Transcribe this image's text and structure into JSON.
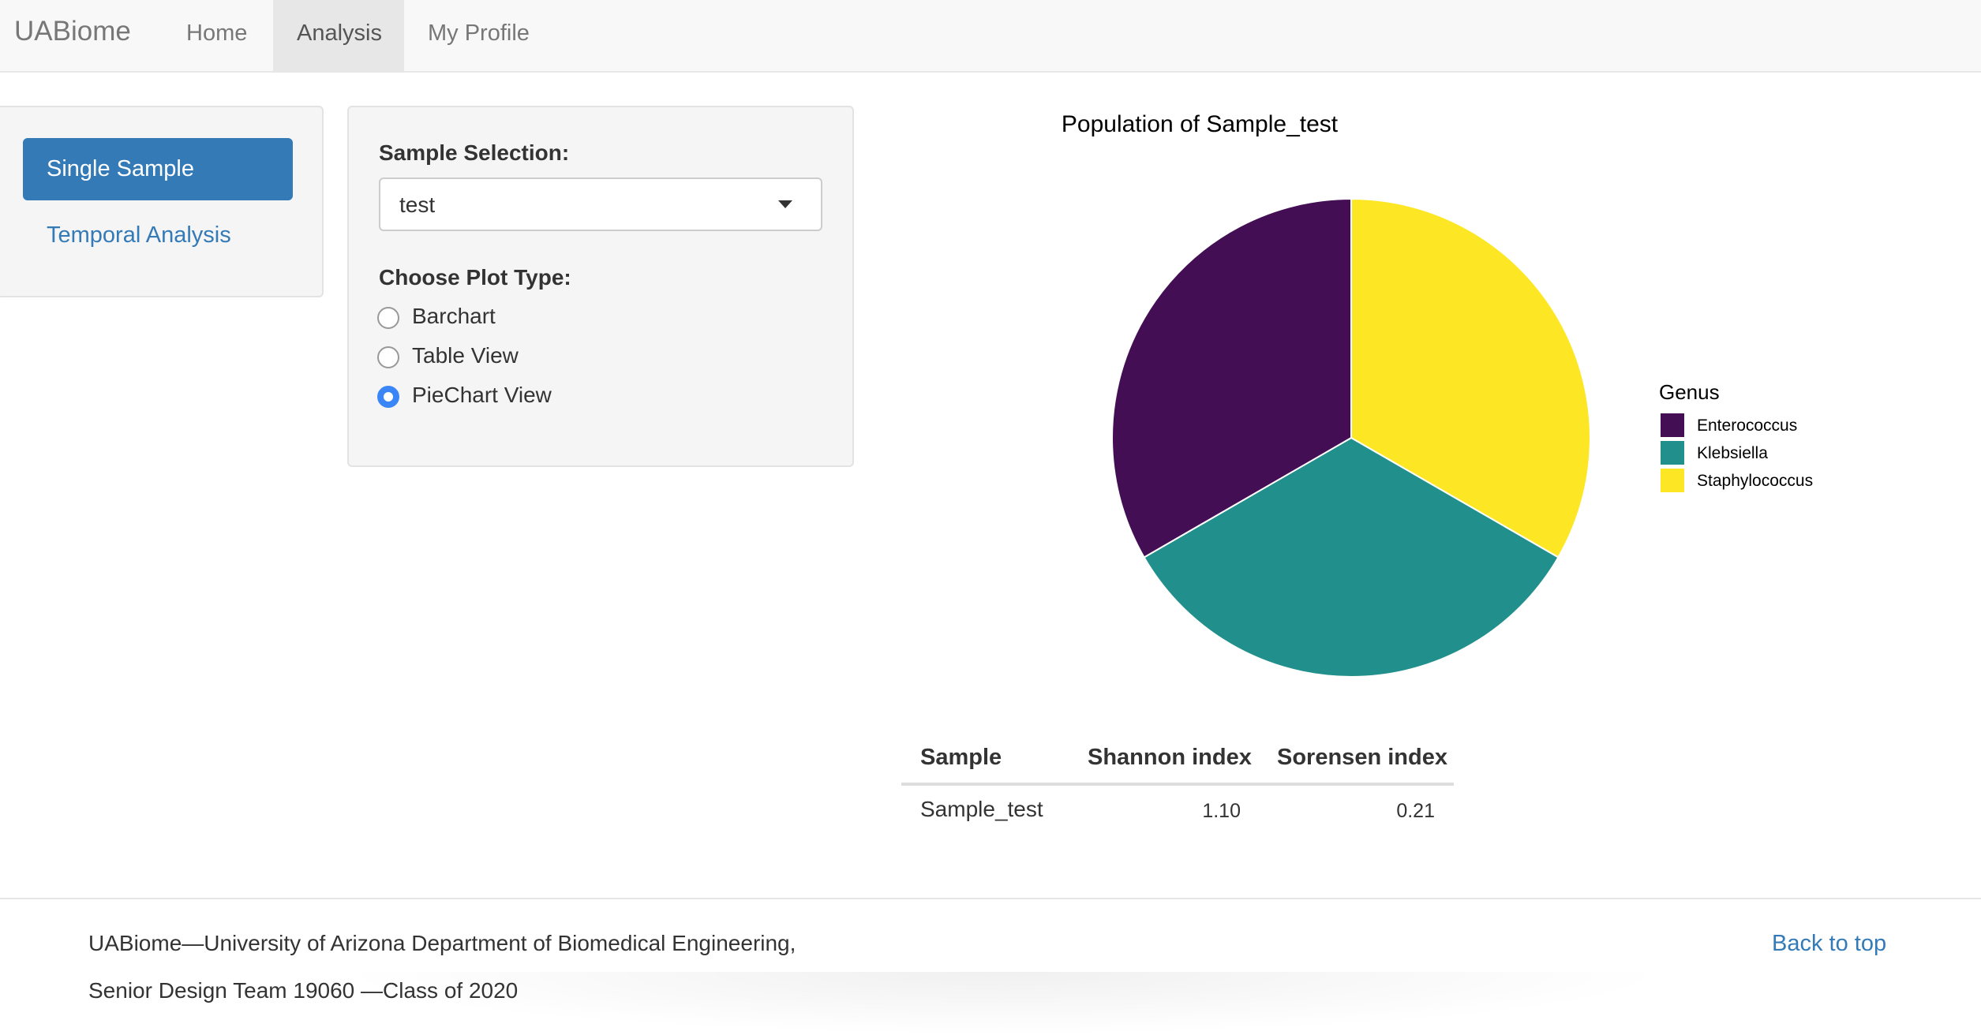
{
  "navbar": {
    "brand": "UABiome",
    "items": [
      {
        "label": "Home",
        "active": false
      },
      {
        "label": "Analysis",
        "active": true
      },
      {
        "label": "My Profile",
        "active": false
      }
    ]
  },
  "side_nav": {
    "items": [
      {
        "label": "Single Sample",
        "active": true
      },
      {
        "label": "Temporal Analysis",
        "active": false
      }
    ]
  },
  "controls": {
    "sample_label": "Sample Selection:",
    "sample_value": "test",
    "plot_type_label": "Choose Plot Type:",
    "plot_types": [
      {
        "label": "Barchart",
        "checked": false
      },
      {
        "label": "Table View",
        "checked": false
      },
      {
        "label": "PieChart View",
        "checked": true
      }
    ]
  },
  "chart_data": {
    "type": "pie",
    "title": "Population of  Sample_test",
    "legend_title": "Genus",
    "legend_position": "right",
    "slices": [
      {
        "label": "Enterococcus",
        "value": 33.33,
        "color": "#440e55"
      },
      {
        "label": "Klebsiella",
        "value": 33.33,
        "color": "#21908d"
      },
      {
        "label": "Staphylococcus",
        "value": 33.33,
        "color": "#fde725"
      }
    ]
  },
  "stats_table": {
    "headers": [
      "Sample",
      "Shannon index",
      "Sorensen index"
    ],
    "rows": [
      [
        "Sample_test",
        "1.10",
        "0.21"
      ]
    ]
  },
  "footer": {
    "line1": "UABiome—University of Arizona Department of Biomedical Engineering,",
    "line2": "Senior Design Team 19060 —Class of 2020",
    "back_to_top": "Back to top"
  },
  "colors": {
    "primary": "#337ab7",
    "radio_checked": "#3b86f7"
  }
}
